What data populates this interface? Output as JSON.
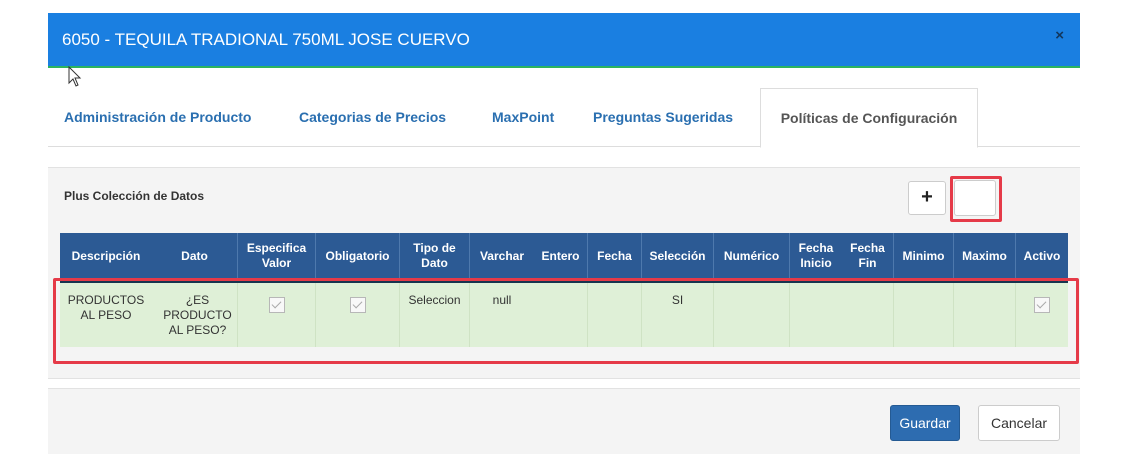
{
  "modal": {
    "title": "6050 - TEQUILA TRADIONAL 750ML JOSE CUERVO",
    "close_symbol": "×"
  },
  "tabs": [
    {
      "label": "Administración de Producto"
    },
    {
      "label": "Categorias de Precios"
    },
    {
      "label": "MaxPoint"
    },
    {
      "label": "Preguntas Sugeridas"
    },
    {
      "label": "Políticas de Configuración",
      "active": true
    }
  ],
  "panel": {
    "title": "Plus Colección de Datos",
    "add_label": "+"
  },
  "table": {
    "headers": [
      "Descripción",
      "Dato",
      "Especifica Valor",
      "Obligatorio",
      "Tipo de Dato",
      "Varchar",
      "Entero",
      "Fecha",
      "Selección",
      "Numérico",
      "Fecha Inicio",
      "Fecha Fin",
      "Minimo",
      "Maximo",
      "Activo"
    ],
    "row": {
      "descripcion": "PRODUCTOS AL PESO",
      "dato": "¿ES PRODUCTO AL PESO?",
      "especifica_valor": true,
      "obligatorio": true,
      "tipo_de_dato": "Seleccion",
      "varchar": "null",
      "entero": "",
      "fecha": "",
      "seleccion": "SI",
      "numerico": "",
      "fecha_inicio": "",
      "fecha_fin": "",
      "minimo": "",
      "maximo": "",
      "activo": true
    }
  },
  "footer": {
    "save_label": "Guardar",
    "cancel_label": "Cancelar"
  },
  "colors": {
    "header_bg": "#1a7fe1",
    "table_header_bg": "#2c5a94",
    "row_bg": "#dff0d7",
    "highlight": "#e53a48",
    "primary_button": "#2d6cb0"
  }
}
